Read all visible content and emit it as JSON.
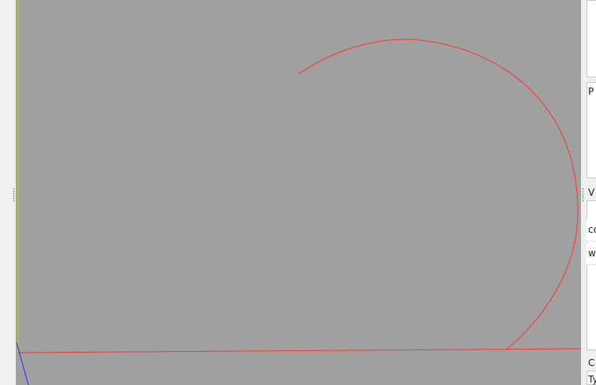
{
  "viewport": {
    "background": "#a0a0a0",
    "axis_colors": {
      "x_axis": "#ff3030",
      "y_axis": "#b4d000",
      "z_axis": "#2030ff"
    },
    "curve_color": "#ff3030"
  },
  "right_panel": {
    "section_properties_label": "P",
    "section_values_label": "V",
    "rows": [
      {
        "key": "co"
      },
      {
        "key": "w"
      }
    ],
    "section_bottom_label": "C",
    "bottom_field_label": "Ty"
  }
}
